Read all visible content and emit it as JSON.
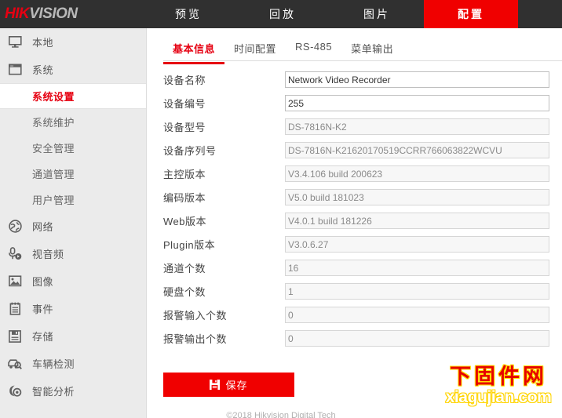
{
  "brand": {
    "logo_hik": "HIK",
    "logo_vision": "VISION",
    "accent_red": "#e60012",
    "topbar_bg": "#303030",
    "active_tab_red": "#f00000"
  },
  "topnav": {
    "items": [
      {
        "label": "预览",
        "active": false
      },
      {
        "label": "回放",
        "active": false
      },
      {
        "label": "图片",
        "active": false
      },
      {
        "label": "配置",
        "active": true
      }
    ]
  },
  "sidebar": {
    "items": [
      {
        "label": "本地",
        "icon": "monitor-icon",
        "type": "group"
      },
      {
        "label": "系统",
        "icon": "window-icon",
        "type": "group"
      },
      {
        "label": "系统设置",
        "icon": "",
        "type": "sub",
        "active": true
      },
      {
        "label": "系统维护",
        "icon": "",
        "type": "sub",
        "active": false
      },
      {
        "label": "安全管理",
        "icon": "",
        "type": "sub",
        "active": false
      },
      {
        "label": "通道管理",
        "icon": "",
        "type": "sub",
        "active": false
      },
      {
        "label": "用户管理",
        "icon": "",
        "type": "sub",
        "active": false
      },
      {
        "label": "网络",
        "icon": "globe-icon",
        "type": "group"
      },
      {
        "label": "视音频",
        "icon": "microphone-icon",
        "type": "group"
      },
      {
        "label": "图像",
        "icon": "image-icon",
        "type": "group"
      },
      {
        "label": "事件",
        "icon": "clipboard-icon",
        "type": "group"
      },
      {
        "label": "存储",
        "icon": "floppy-disk-icon",
        "type": "group"
      },
      {
        "label": "车辆检测",
        "icon": "car-search-icon",
        "type": "group"
      },
      {
        "label": "智能分析",
        "icon": "smart-analysis-icon",
        "type": "group"
      }
    ]
  },
  "tabs": [
    {
      "label": "基本信息",
      "active": true
    },
    {
      "label": "时间配置",
      "active": false
    },
    {
      "label": "RS-485",
      "active": false
    },
    {
      "label": "菜单输出",
      "active": false
    }
  ],
  "form": {
    "rows": [
      {
        "label": "设备名称",
        "value": "Network Video Recorder",
        "readonly": false
      },
      {
        "label": "设备编号",
        "value": "255",
        "readonly": false
      },
      {
        "label": "设备型号",
        "value": "DS-7816N-K2",
        "readonly": true
      },
      {
        "label": "设备序列号",
        "value": "DS-7816N-K21620170519CCRR766063822WCVU",
        "readonly": true
      },
      {
        "label": "主控版本",
        "value": "V3.4.106 build 200623",
        "readonly": true
      },
      {
        "label": "编码版本",
        "value": "V5.0 build 181023",
        "readonly": true
      },
      {
        "label": "Web版本",
        "value": "V4.0.1 build 181226",
        "readonly": true
      },
      {
        "label": "Plugin版本",
        "value": "V3.0.6.27",
        "readonly": true
      },
      {
        "label": "通道个数",
        "value": "16",
        "readonly": true
      },
      {
        "label": "硬盘个数",
        "value": "1",
        "readonly": true
      },
      {
        "label": "报警输入个数",
        "value": "0",
        "readonly": true
      },
      {
        "label": "报警输出个数",
        "value": "0",
        "readonly": true
      }
    ],
    "save_label": "保存",
    "save_icon": "floppy-disk-icon"
  },
  "watermark": {
    "cn": "下固件网",
    "en": "xiagujian.com"
  },
  "footer": {
    "copyright": "©2018 Hikvision Digital Tech"
  }
}
